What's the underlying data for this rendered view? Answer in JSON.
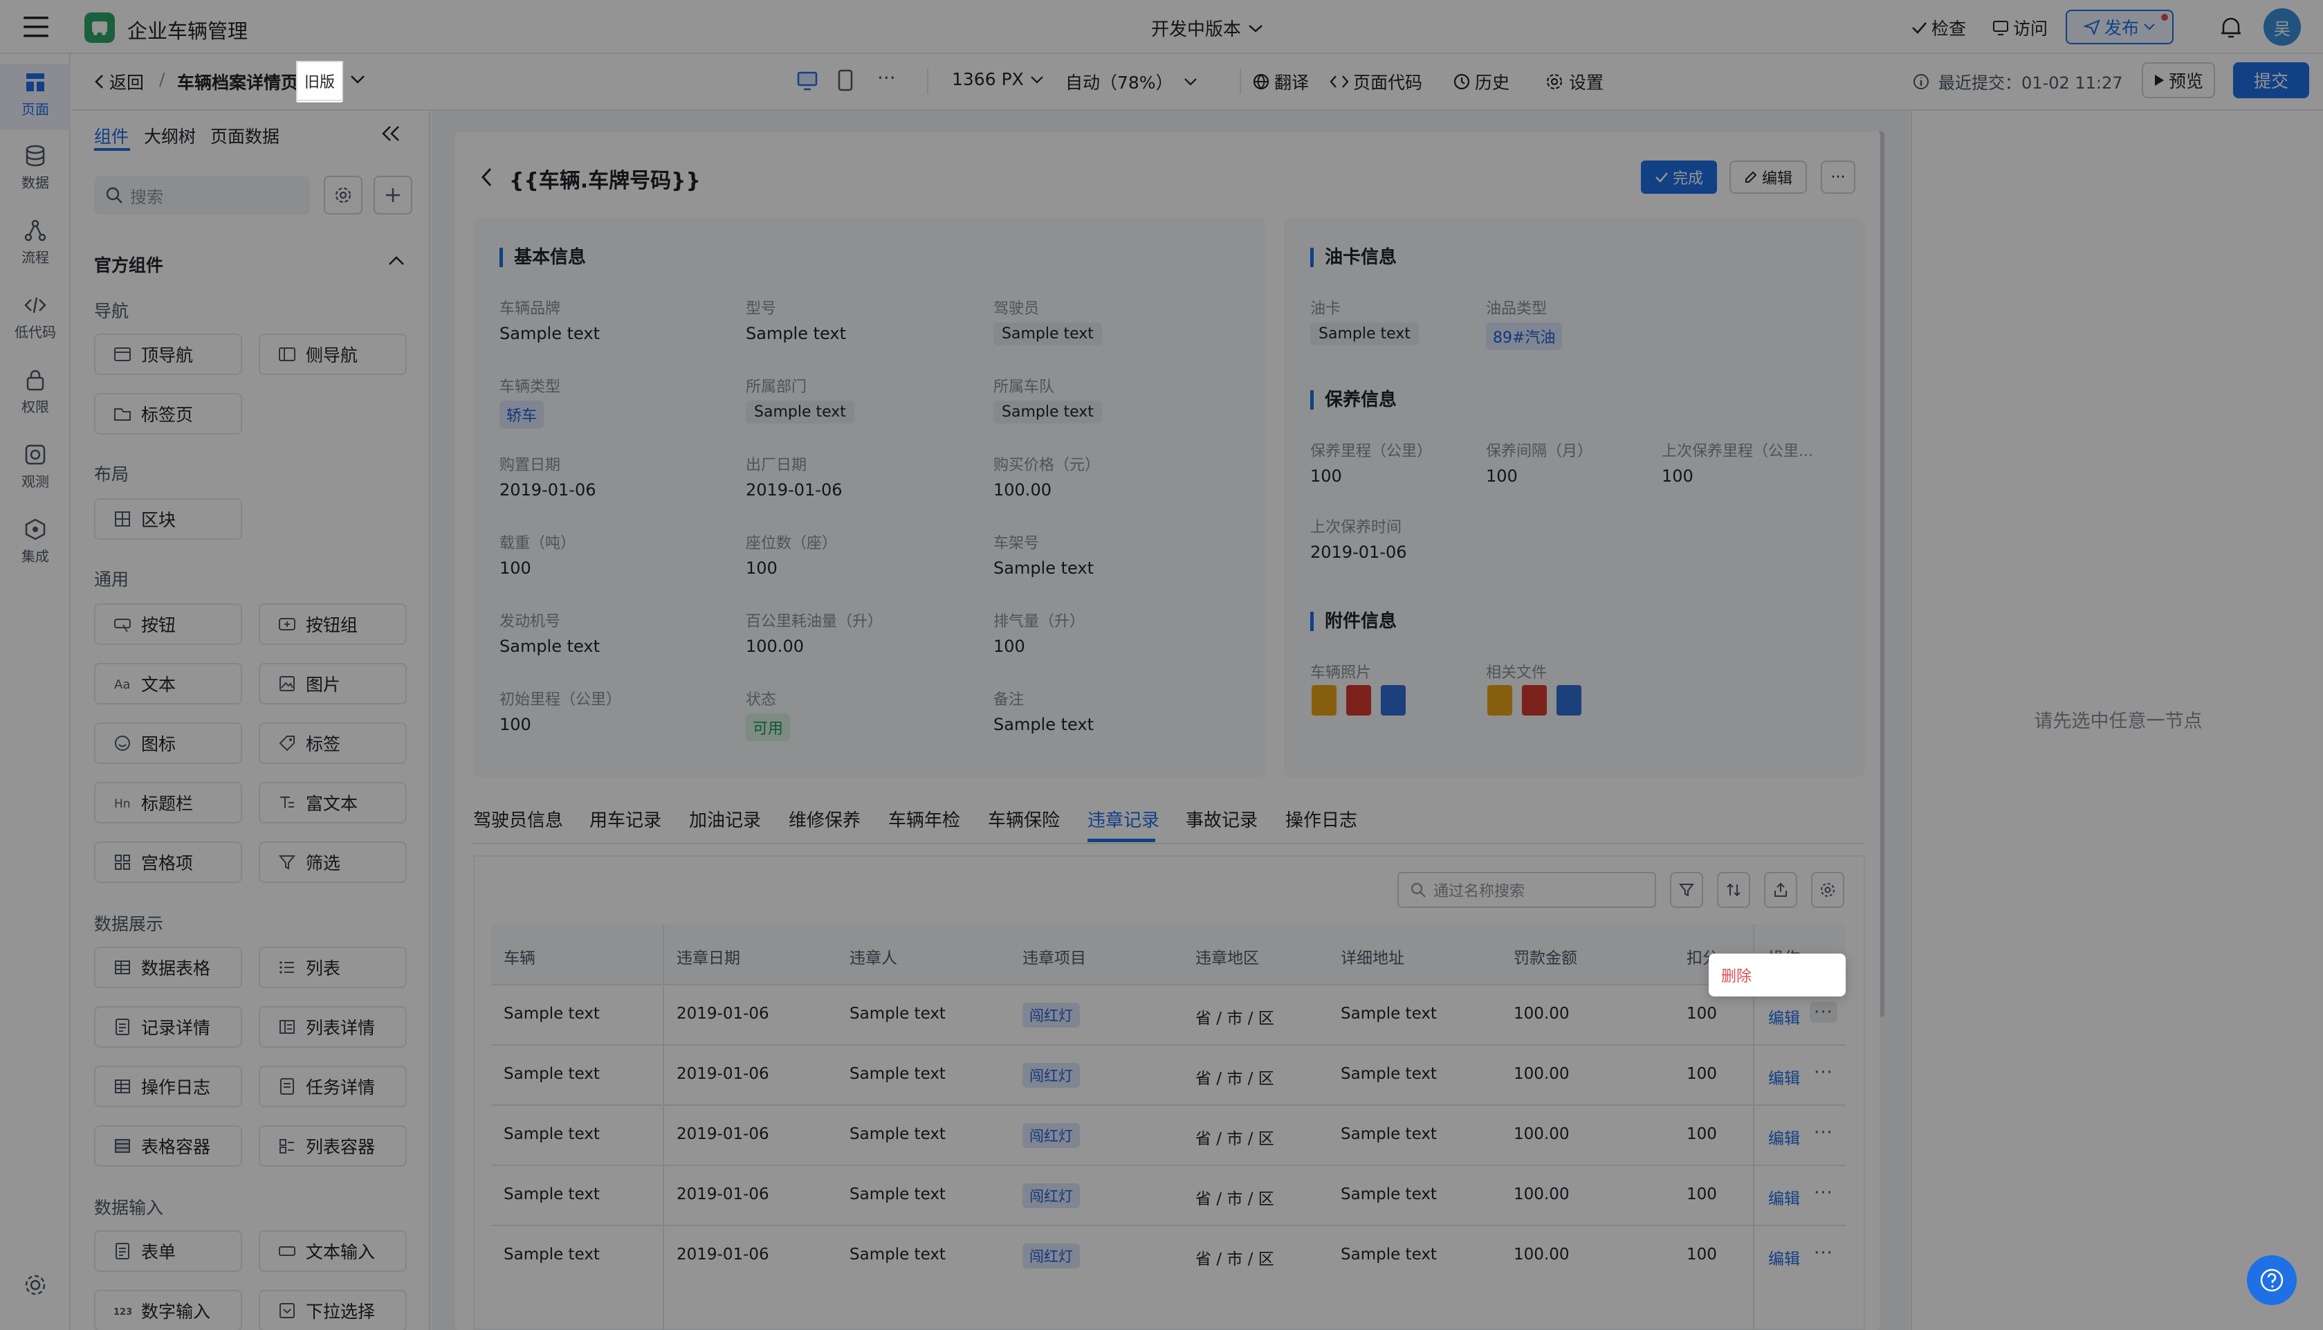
{
  "app": {
    "title": "企业车辆管理",
    "version_label": "开发中版本",
    "check": "检查",
    "visit": "访问",
    "publish": "发布",
    "avatar": "吴"
  },
  "rail": [
    {
      "label": "页面",
      "icon": "pages-icon"
    },
    {
      "label": "数据",
      "icon": "database-icon"
    },
    {
      "label": "流程",
      "icon": "flow-icon"
    },
    {
      "label": "低代码",
      "icon": "code-icon"
    },
    {
      "label": "权限",
      "icon": "lock-icon"
    },
    {
      "label": "观测",
      "icon": "monitor-icon"
    },
    {
      "label": "集成",
      "icon": "integration-icon"
    }
  ],
  "toolbar": {
    "back": "返回",
    "sep": "/",
    "page_name": "车辆档案详情页",
    "old_badge": "旧版",
    "width": "1366 PX",
    "zoom": "自动（78%）",
    "translate": "翻译",
    "page_code": "页面代码",
    "history": "历史",
    "settings": "设置",
    "last_commit": "最近提交：01-02 11:27",
    "preview": "预览",
    "submit": "提交"
  },
  "sidebar": {
    "tabs": [
      "组件",
      "大纲树",
      "页面数据"
    ],
    "search_placeholder": "搜索",
    "section_title": "官方组件",
    "groups": [
      {
        "title": "导航",
        "items": [
          {
            "label": "顶导航",
            "icon": "top-nav-icon"
          },
          {
            "label": "侧导航",
            "icon": "side-nav-icon"
          },
          {
            "label": "标签页",
            "icon": "tabs-icon"
          }
        ]
      },
      {
        "title": "布局",
        "items": [
          {
            "label": "区块",
            "icon": "block-icon"
          }
        ]
      },
      {
        "title": "通用",
        "items": [
          {
            "label": "按钮",
            "icon": "button-icon"
          },
          {
            "label": "按钮组",
            "icon": "button-group-icon"
          },
          {
            "label": "文本",
            "icon": "text-icon"
          },
          {
            "label": "图片",
            "icon": "image-icon"
          },
          {
            "label": "图标",
            "icon": "smile-icon"
          },
          {
            "label": "标签",
            "icon": "tag-icon"
          },
          {
            "label": "标题栏",
            "icon": "heading-icon"
          },
          {
            "label": "富文本",
            "icon": "rich-text-icon"
          },
          {
            "label": "宫格项",
            "icon": "grid-icon"
          },
          {
            "label": "筛选",
            "icon": "filter-icon"
          }
        ]
      },
      {
        "title": "数据展示",
        "items": [
          {
            "label": "数据表格",
            "icon": "table-icon"
          },
          {
            "label": "列表",
            "icon": "list-icon"
          },
          {
            "label": "记录详情",
            "icon": "record-icon"
          },
          {
            "label": "列表详情",
            "icon": "list-detail-icon"
          },
          {
            "label": "操作日志",
            "icon": "log-icon"
          },
          {
            "label": "任务详情",
            "icon": "task-icon"
          },
          {
            "label": "表格容器",
            "icon": "table-container-icon"
          },
          {
            "label": "列表容器",
            "icon": "list-container-icon"
          }
        ]
      },
      {
        "title": "数据输入",
        "items": [
          {
            "label": "表单",
            "icon": "form-icon"
          },
          {
            "label": "文本输入",
            "icon": "input-icon"
          },
          {
            "label": "数字输入",
            "icon": "number-icon"
          },
          {
            "label": "下拉选择",
            "icon": "select-icon"
          }
        ]
      }
    ]
  },
  "page": {
    "title": "{{车辆.车牌号码}}",
    "done": "完成",
    "edit": "编辑",
    "more": "···",
    "basic": {
      "title": "基本信息",
      "fields": [
        {
          "label": "车辆品牌",
          "value": "Sample text",
          "kind": "text"
        },
        {
          "label": "型号",
          "value": "Sample text",
          "kind": "text"
        },
        {
          "label": "驾驶员",
          "value": "Sample text",
          "kind": "pill"
        },
        {
          "label": "车辆类型",
          "value": "轿车",
          "kind": "tag-blue"
        },
        {
          "label": "所属部门",
          "value": "Sample text",
          "kind": "pill"
        },
        {
          "label": "所属车队",
          "value": "Sample text",
          "kind": "pill"
        },
        {
          "label": "购置日期",
          "value": "2019-01-06",
          "kind": "text"
        },
        {
          "label": "出厂日期",
          "value": "2019-01-06",
          "kind": "text"
        },
        {
          "label": "购买价格（元）",
          "value": "100.00",
          "kind": "text"
        },
        {
          "label": "载重（吨）",
          "value": "100",
          "kind": "text"
        },
        {
          "label": "座位数（座）",
          "value": "100",
          "kind": "text"
        },
        {
          "label": "车架号",
          "value": "Sample text",
          "kind": "text"
        },
        {
          "label": "发动机号",
          "value": "Sample text",
          "kind": "text"
        },
        {
          "label": "百公里耗油量（升）",
          "value": "100.00",
          "kind": "text"
        },
        {
          "label": "排气量（升）",
          "value": "100",
          "kind": "text"
        },
        {
          "label": "初始里程（公里）",
          "value": "100",
          "kind": "text"
        },
        {
          "label": "状态",
          "value": "可用",
          "kind": "tag-green"
        },
        {
          "label": "备注",
          "value": "Sample text",
          "kind": "text"
        }
      ]
    },
    "fuel": {
      "title": "油卡信息",
      "card_label": "油卡",
      "card_value": "Sample text",
      "type_label": "油品类型",
      "type_value": "89#汽油"
    },
    "maint": {
      "title": "保养信息",
      "f1_label": "保养里程（公里）",
      "f1_value": "100",
      "f2_label": "保养间隔（月）",
      "f2_value": "100",
      "f3_label": "上次保养里程（公里...",
      "f3_value": "100",
      "f4_label": "上次保养时间",
      "f4_value": "2019-01-06"
    },
    "attach": {
      "title": "附件信息",
      "photos_label": "车辆照片",
      "files_label": "相关文件"
    },
    "tabs": [
      "驾驶员信息",
      "用车记录",
      "加油记录",
      "维修保养",
      "车辆年检",
      "车辆保险",
      "违章记录",
      "事故记录",
      "操作日志"
    ],
    "active_tab": "违章记录",
    "table": {
      "search_placeholder": "通过名称搜索",
      "columns": [
        "车辆",
        "违章日期",
        "违章人",
        "违章项目",
        "违章地区",
        "详细地址",
        "罚款金额",
        "扣分",
        "操作"
      ],
      "rows": [
        [
          "Sample text",
          "2019-01-06",
          "Sample text",
          "闯红灯",
          "省 / 市 / 区",
          "Sample text",
          "100.00",
          "100"
        ],
        [
          "Sample text",
          "2019-01-06",
          "Sample text",
          "闯红灯",
          "省 / 市 / 区",
          "Sample text",
          "100.00",
          "100"
        ],
        [
          "Sample text",
          "2019-01-06",
          "Sample text",
          "闯红灯",
          "省 / 市 / 区",
          "Sample text",
          "100.00",
          "100"
        ],
        [
          "Sample text",
          "2019-01-06",
          "Sample text",
          "闯红灯",
          "省 / 市 / 区",
          "Sample text",
          "100.00",
          "100"
        ],
        [
          "Sample text",
          "2019-01-06",
          "Sample text",
          "闯红灯",
          "省 / 市 / 区",
          "Sample text",
          "100.00",
          "100"
        ]
      ],
      "row_edit": "编辑",
      "row_more": "···",
      "popup_delete": "删除"
    }
  },
  "right_panel": {
    "empty_hint": "请先选中任意一节点"
  },
  "colors": {
    "accent": "#1f6fe5",
    "page_bg": "#f2f3f5",
    "overlay": "rgba(0,0,0,0.42)",
    "danger": "#e34d59"
  }
}
